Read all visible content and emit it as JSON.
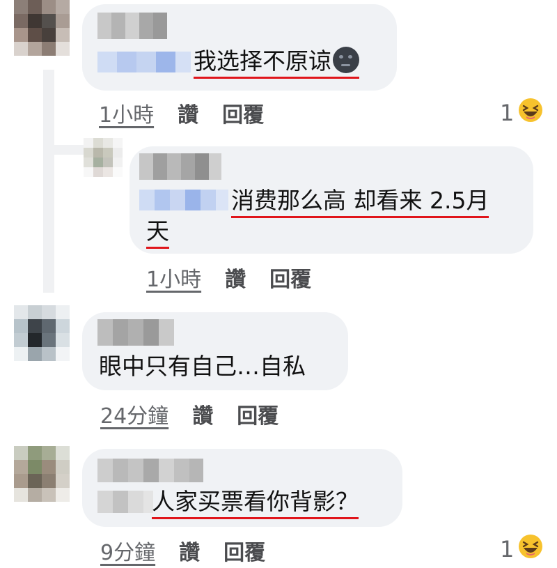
{
  "comments": [
    {
      "text": "我选择不原谅",
      "emoji": "new-moon-face-emoji",
      "time": "1小時",
      "like": "讚",
      "reply": "回覆",
      "reaction_count": "1",
      "reaction_icon": "laughing-face-icon"
    },
    {
      "text_line1": "消费那么高 却看来 2.5月",
      "text_line2": "天",
      "time": "1小時",
      "like": "讚",
      "reply": "回覆"
    },
    {
      "text": "眼中只有自己…自私",
      "time": "24分鐘",
      "like": "讚",
      "reply": "回覆"
    },
    {
      "text": "人家买票看你背影？",
      "time": "9分鐘",
      "like": "讚",
      "reply": "回覆",
      "reaction_count": "1",
      "reaction_icon": "laughing-face-icon"
    }
  ],
  "colors": {
    "bubble": "#f0f2f5",
    "underline": "#e0151b",
    "meta": "#65676b",
    "reaction": "#f7c22d"
  }
}
